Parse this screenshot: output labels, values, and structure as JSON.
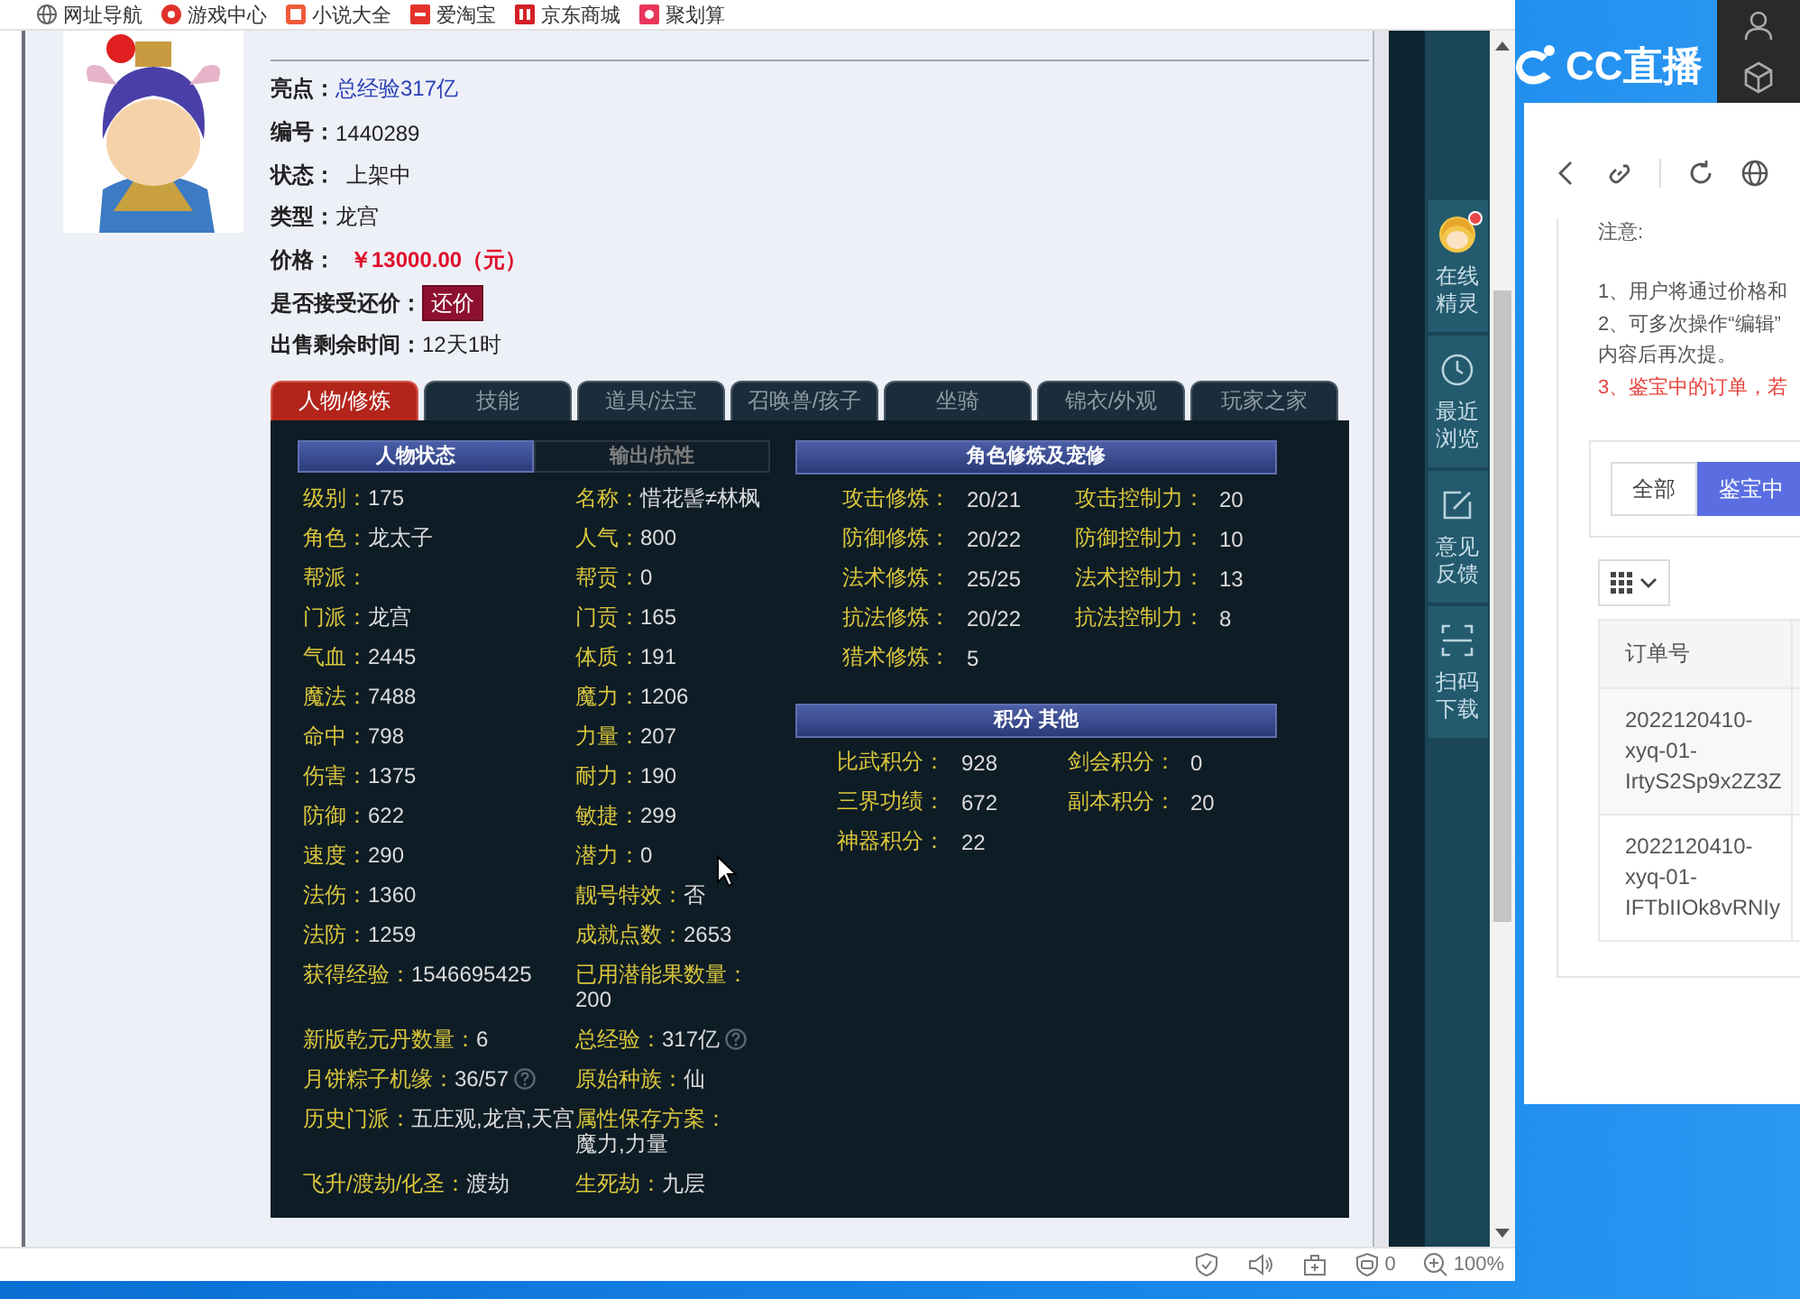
{
  "bookmarks": [
    {
      "label": "网址导航"
    },
    {
      "label": "游戏中心"
    },
    {
      "label": "小说大全"
    },
    {
      "label": "爱淘宝"
    },
    {
      "label": "京东商城"
    },
    {
      "label": "聚划算"
    }
  ],
  "details": [
    {
      "label": "亮点：",
      "value": "总经验317亿",
      "kind": "link"
    },
    {
      "label": "编号：",
      "value": "1440289",
      "kind": "text"
    },
    {
      "label": "状态：",
      "value": "上架中",
      "kind": "status"
    },
    {
      "label": "类型：",
      "value": "龙宫",
      "kind": "text"
    },
    {
      "label": "价格：",
      "value": "￥13000.00（元）",
      "kind": "price"
    },
    {
      "label": "是否接受还价：",
      "value": "还价",
      "kind": "button"
    },
    {
      "label": "出售剩余时间：",
      "value": "12天1时",
      "kind": "text"
    }
  ],
  "tabs": [
    {
      "label": "人物/修炼",
      "selected": true
    },
    {
      "label": "技能",
      "selected": false
    },
    {
      "label": "道具/法宝",
      "selected": false
    },
    {
      "label": "召唤兽/孩子",
      "selected": false
    },
    {
      "label": "坐骑",
      "selected": false
    },
    {
      "label": "锦衣/外观",
      "selected": false
    },
    {
      "label": "玩家之家",
      "selected": false
    }
  ],
  "subtabs": [
    {
      "label": "人物状态",
      "selected": true
    },
    {
      "label": "输出/抗性",
      "selected": false
    }
  ],
  "stats": [
    {
      "label": "级别：",
      "value": "175",
      "help": false
    },
    {
      "label": "名称：",
      "value": "惜花髻≠林枫",
      "help": false
    },
    {
      "label": "角色：",
      "value": "龙太子",
      "help": false
    },
    {
      "label": "人气：",
      "value": "800",
      "help": false
    },
    {
      "label": "帮派：",
      "help": false
    },
    {
      "label": "帮贡：",
      "value": "0",
      "help": false
    },
    {
      "label": "门派：",
      "value": "龙宫",
      "help": false
    },
    {
      "label": "门贡：",
      "value": "165",
      "help": false
    },
    {
      "label": "气血：",
      "value": "2445",
      "help": false
    },
    {
      "label": "体质：",
      "value": "191",
      "help": false
    },
    {
      "label": "魔法：",
      "value": "7488",
      "help": false
    },
    {
      "label": "魔力：",
      "value": "1206",
      "help": false
    },
    {
      "label": "命中：",
      "value": "798",
      "help": false
    },
    {
      "label": "力量：",
      "value": "207",
      "help": false
    },
    {
      "label": "伤害：",
      "value": "1375",
      "help": false
    },
    {
      "label": "耐力：",
      "value": "190",
      "help": false
    },
    {
      "label": "防御：",
      "value": "622",
      "help": false
    },
    {
      "label": "敏捷：",
      "value": "299",
      "help": false
    },
    {
      "label": "速度：",
      "value": "290",
      "help": false
    },
    {
      "label": "潜力：",
      "value": "0",
      "help": false
    },
    {
      "label": "法伤：",
      "value": "1360",
      "help": false
    },
    {
      "label": "靓号特效：",
      "value": "否",
      "help": false
    },
    {
      "label": "法防：",
      "value": "1259",
      "help": false
    },
    {
      "label": "成就点数：",
      "value": "2653",
      "help": false
    },
    {
      "label": "获得经验：",
      "value": "1546695425",
      "help": false
    },
    {
      "label": "已用潜能果数量：",
      "value": "200",
      "help": false
    },
    {
      "label": "新版乾元丹数量：",
      "value": "6",
      "help": false
    },
    {
      "label": "总经验：",
      "value": "317亿",
      "help": true
    },
    {
      "label": "月饼粽子机缘：",
      "value": "36/57",
      "help": true
    },
    {
      "label": "原始种族：",
      "value": "仙",
      "help": false
    },
    {
      "label": "历史门派：",
      "value": "五庄观,龙宫,天宫",
      "help": false
    },
    {
      "label": "属性保存方案：",
      "value": "魔力,力量",
      "help": false
    },
    {
      "label": "飞升/渡劫/化圣：",
      "value": "渡劫",
      "help": false
    },
    {
      "label": "生死劫：",
      "value": "九层",
      "help": false
    }
  ],
  "cultivation": {
    "title": "角色修炼及宠修",
    "items": [
      {
        "label": "攻击修炼：",
        "value": "20/21"
      },
      {
        "label": "攻击控制力：",
        "value": "20"
      },
      {
        "label": "防御修炼：",
        "value": "20/22"
      },
      {
        "label": "防御控制力：",
        "value": "10"
      },
      {
        "label": "法术修炼：",
        "value": "25/25"
      },
      {
        "label": "法术控制力：",
        "value": "13"
      },
      {
        "label": "抗法修炼：",
        "value": "20/22"
      },
      {
        "label": "抗法控制力：",
        "value": "8"
      },
      {
        "label": "猎术修炼：",
        "value": "5"
      }
    ]
  },
  "points": {
    "title": "积分 其他",
    "items": [
      {
        "label": "比武积分：",
        "value": "928"
      },
      {
        "label": "剑会积分：",
        "value": "0"
      },
      {
        "label": "三界功绩：",
        "value": "672"
      },
      {
        "label": "副本积分：",
        "value": "20"
      },
      {
        "label": "神器积分：",
        "value": "22"
      }
    ]
  },
  "sidebar_buttons": [
    {
      "label": "在线精灵",
      "badge": true
    },
    {
      "label": "最近浏览",
      "badge": false
    },
    {
      "label": "意见反馈",
      "badge": false
    },
    {
      "label": "扫码下载",
      "badge": false
    }
  ],
  "status_bar": {
    "adblock_count": "0",
    "zoom": "100%"
  },
  "logo": {
    "text": "CC直播"
  },
  "popup": {
    "notice_title": "注意:",
    "notice_lines": [
      {
        "text": "1、用户将通过价格和",
        "kind": "normal"
      },
      {
        "text": "2、可多次操作“编辑”",
        "kind": "normal"
      },
      {
        "text": "内容后再次提。",
        "kind": "normal"
      },
      {
        "text": "3、鉴宝中的订单，若",
        "kind": "warning"
      }
    ],
    "filters": [
      {
        "label": "全部",
        "selected": false
      },
      {
        "label": "鉴宝中",
        "selected": true
      }
    ],
    "table": {
      "columns": [
        "订单号"
      ],
      "rows": [
        [
          "2022120410-xyq-01-IrtyS2Sp9x2Z3Z"
        ],
        [
          "2022120410-xyq-01-IFTbIIOk8vRNIy"
        ]
      ]
    }
  }
}
